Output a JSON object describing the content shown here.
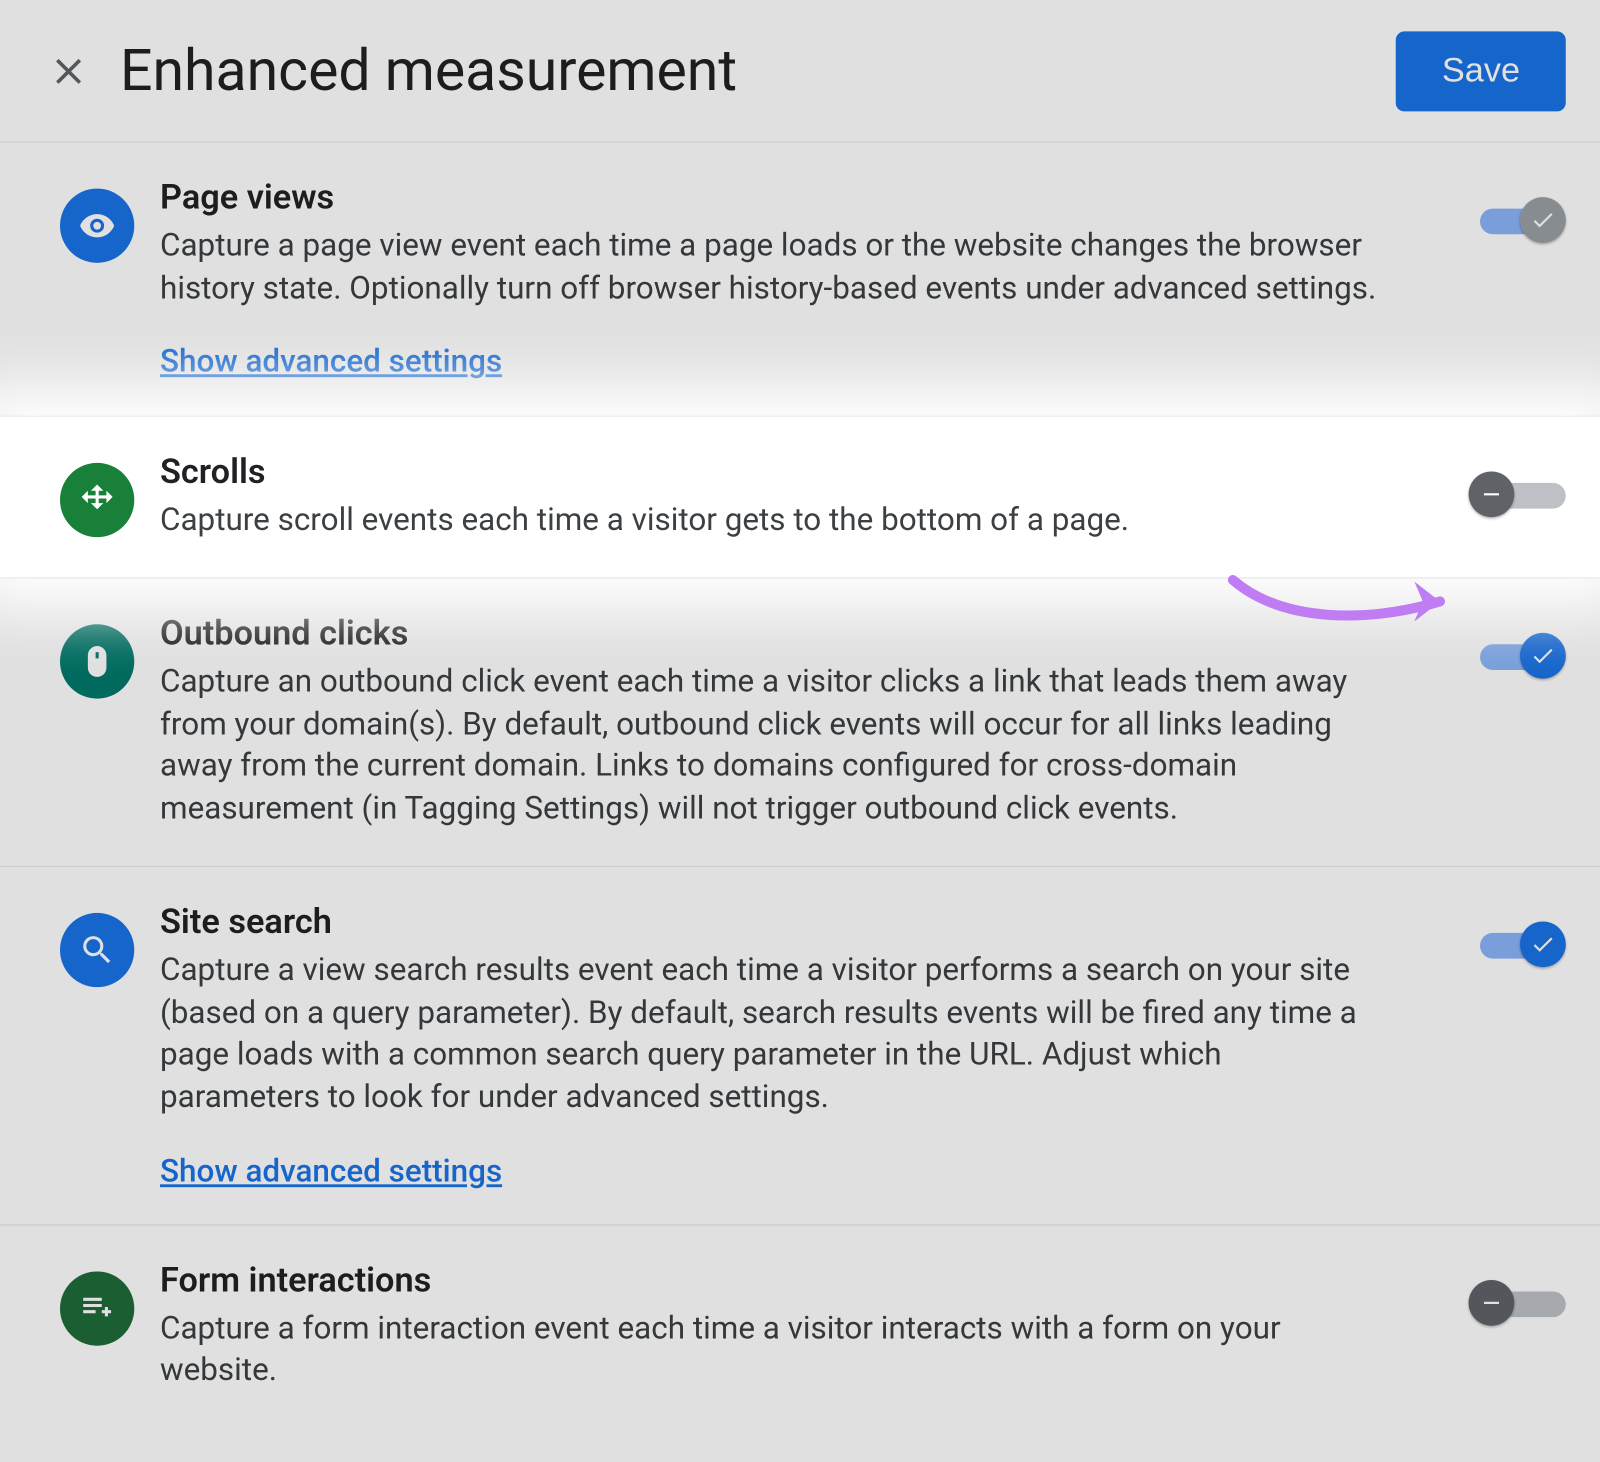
{
  "header": {
    "title": "Enhanced measurement",
    "save_label": "Save"
  },
  "advanced_link_label": "Show advanced settings",
  "items": [
    {
      "key": "page_views",
      "title": "Page views",
      "desc": "Capture a page view event each time a page loads or the website changes the browser history state. Optionally turn off browser history-based events under advanced settings.",
      "toggle_state": "on_locked",
      "has_advanced": true
    },
    {
      "key": "scrolls",
      "title": "Scrolls",
      "desc": "Capture scroll events each time a visitor gets to the bottom of a page.",
      "toggle_state": "off",
      "has_advanced": false,
      "highlighted": true
    },
    {
      "key": "outbound_clicks",
      "title": "Outbound clicks",
      "desc": "Capture an outbound click event each time a visitor clicks a link that leads them away from your domain(s). By default, outbound click events will occur for all links leading away from the current domain. Links to domains configured for cross-domain measurement (in Tagging Settings) will not trigger outbound click events.",
      "toggle_state": "on",
      "has_advanced": false
    },
    {
      "key": "site_search",
      "title": "Site search",
      "desc": "Capture a view search results event each time a visitor performs a search on your site (based on a query parameter). By default, search results events will be fired any time a page loads with a common search query parameter in the URL. Adjust which parameters to look for under advanced settings.",
      "toggle_state": "on",
      "has_advanced": true
    },
    {
      "key": "form_interactions",
      "title": "Form interactions",
      "desc": "Capture a form interaction event each time a visitor interacts with a form on your website.",
      "toggle_state": "off",
      "has_advanced": false
    }
  ]
}
